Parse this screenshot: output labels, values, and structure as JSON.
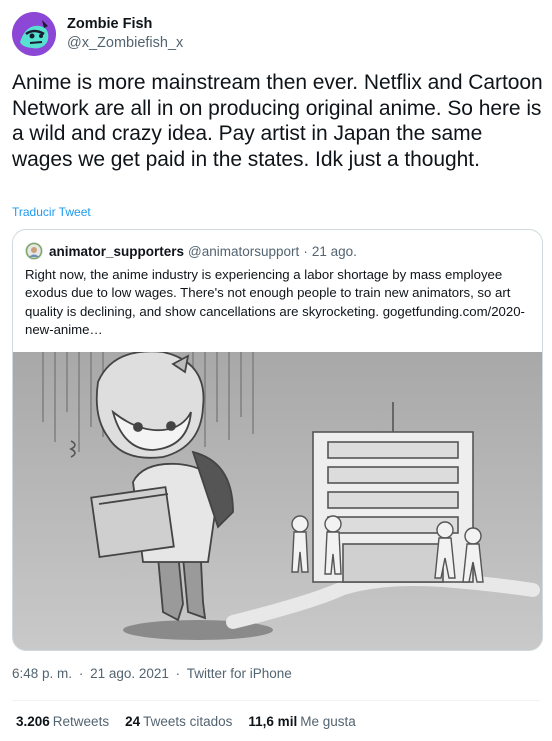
{
  "author": {
    "display_name": "Zombie Fish",
    "handle": "@x_Zombiefish_x",
    "avatar_icon": "zombie-fish-avatar"
  },
  "tweet": {
    "text": "Anime is more mainstream then ever. Netflix and Cartoon Network are all in on producing original anime. So here is a wild and crazy idea. Pay artist in Japan the same wages we get paid in the states. Idk just a thought.",
    "translate_label": "Traducir Tweet"
  },
  "quoted": {
    "display_name": "animator_supporters",
    "handle": "@animatorsupport",
    "separator": "·",
    "date": "21 ago.",
    "text": "Right now, the anime industry is experiencing a labor shortage by mass employee exodus due to low wages. There's not enough people to train new animators, so art quality is declining, and show cancellations are skyrocketing. gogetfunding.com/2020-new-anime…",
    "media_icon": "anime-illustration-image"
  },
  "meta": {
    "time": "6:48 p. m.",
    "sep1": "·",
    "date": "21 ago. 2021",
    "sep2": "·",
    "source": "Twitter for iPhone"
  },
  "stats": {
    "retweets_count": "3.206",
    "retweets_label": "Retweets",
    "quotes_count": "24",
    "quotes_label": "Tweets citados",
    "likes_count": "11,6 mil",
    "likes_label": "Me gusta"
  },
  "colors": {
    "link": "#1d9bf0",
    "secondary_text": "#536471",
    "border": "#cfd9de"
  }
}
